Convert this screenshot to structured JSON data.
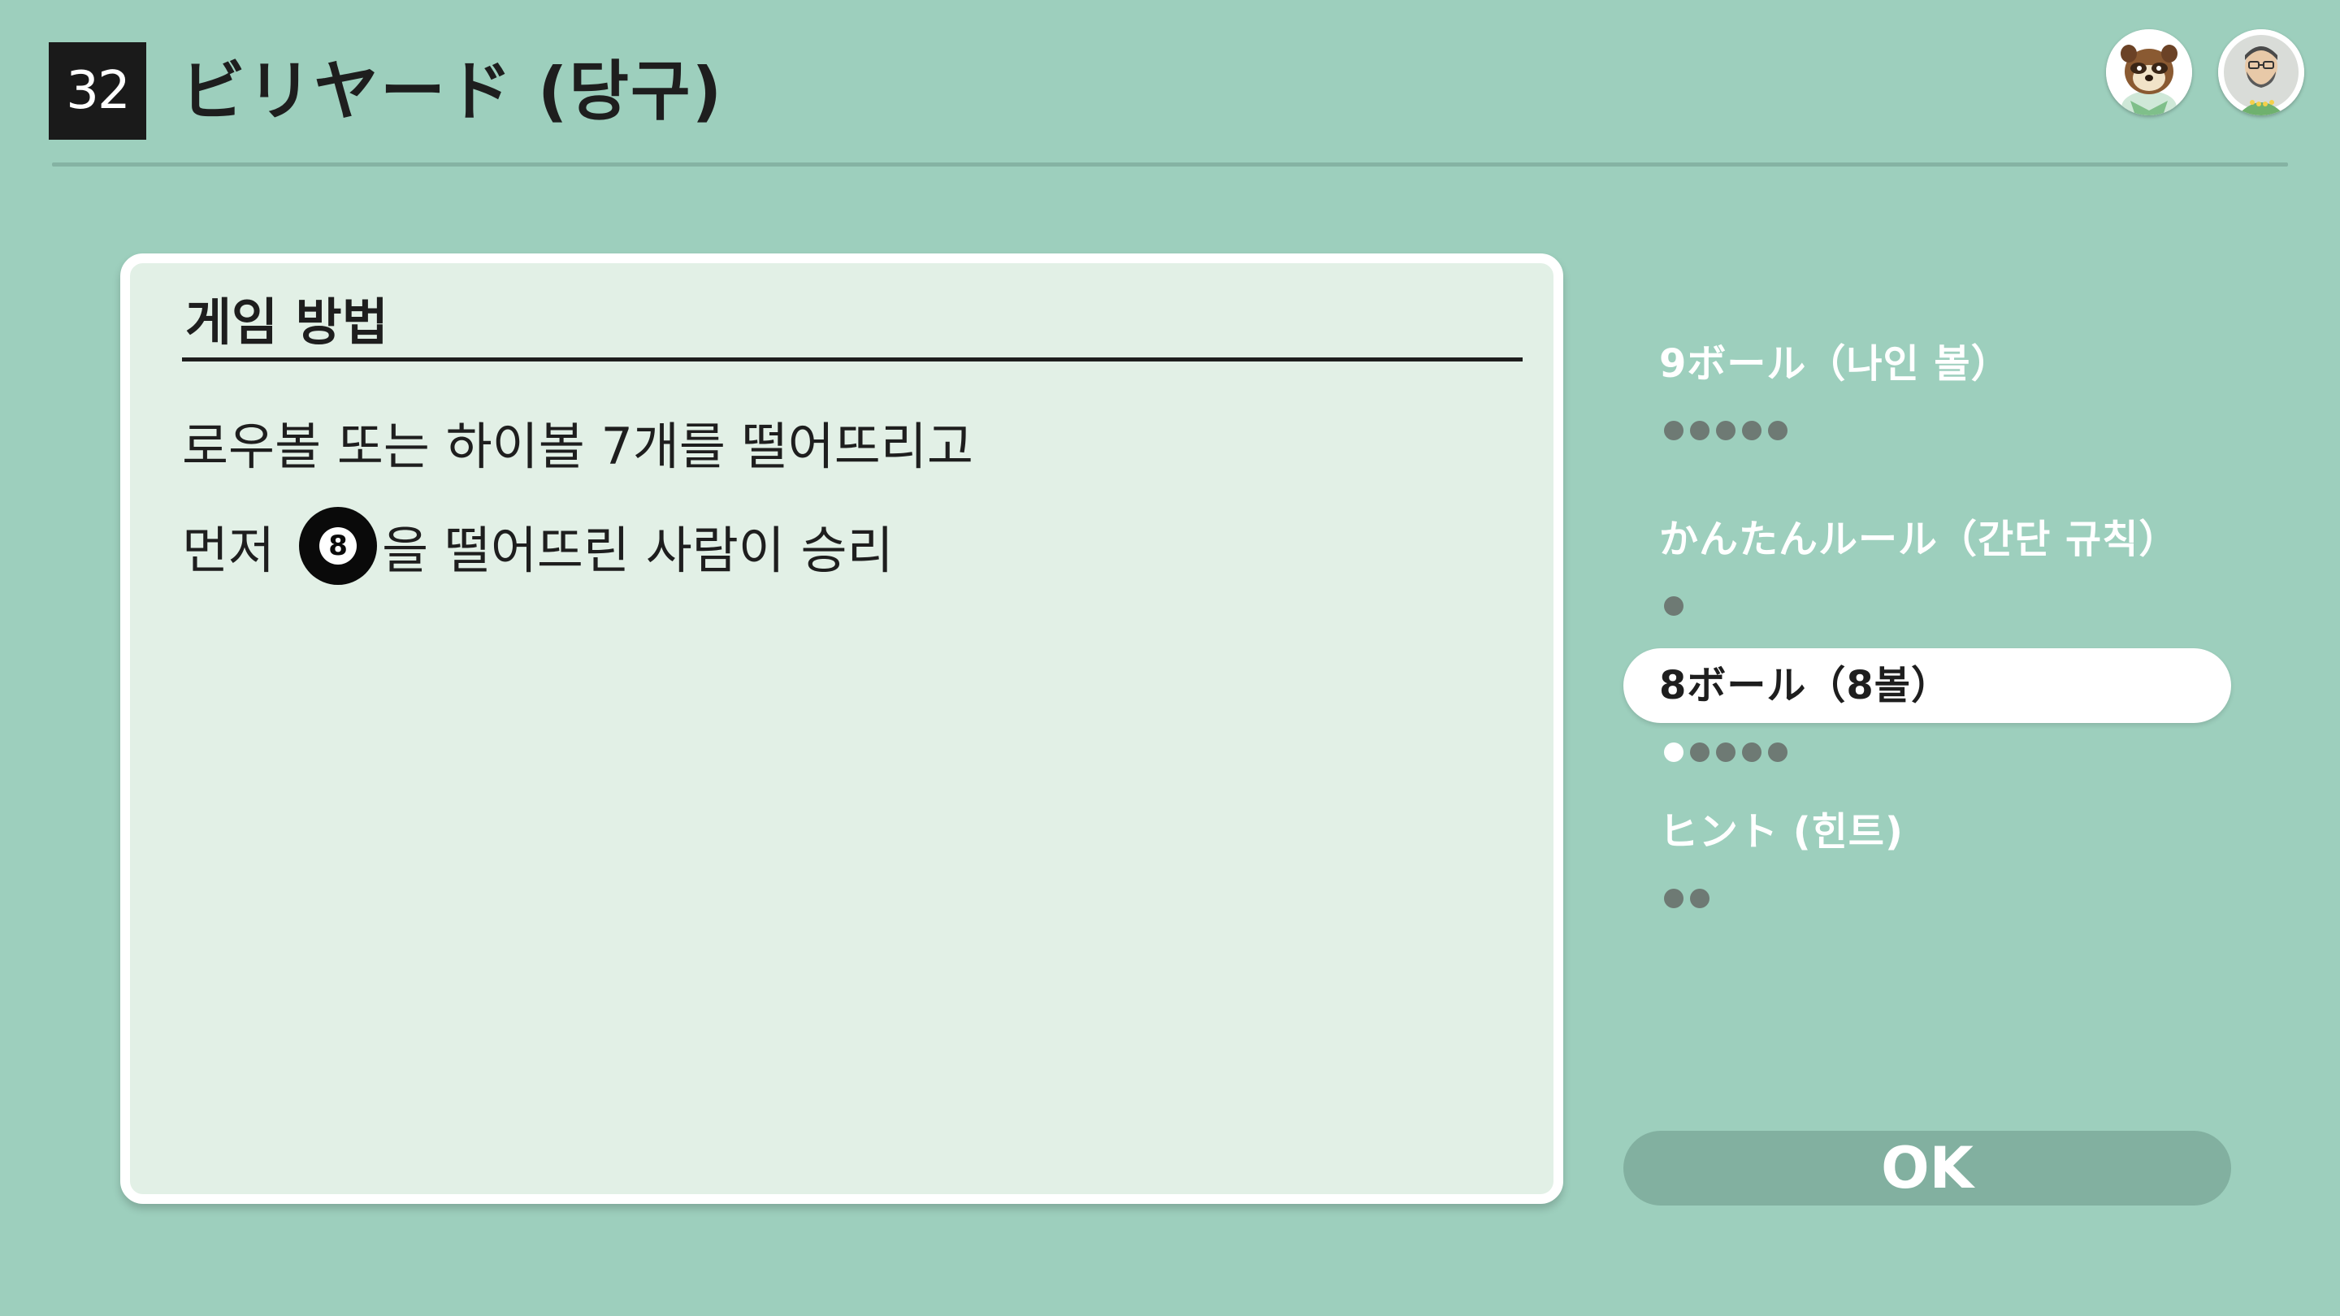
{
  "header": {
    "number": "32",
    "title": "ビリヤード (당구)"
  },
  "card": {
    "title": "게임 방법",
    "line1": "로우볼 또는 하이볼 7개를 떨어뜨리고",
    "line2_prefix": "먼저",
    "ball_number": "8",
    "line2_suffix": "을 떨어뜨린 사람이 승리"
  },
  "menu": {
    "items": [
      {
        "label": "9ボール（나인 볼）",
        "pages": 5,
        "current_page": null
      },
      {
        "label": "かんたんルール（간단 규칙）",
        "pages": 1,
        "current_page": null
      },
      {
        "label": "8ボール（8볼）",
        "pages": 5,
        "current_page": 1,
        "selected": true
      },
      {
        "label": "ヒント (힌트)",
        "pages": 2,
        "current_page": null
      }
    ]
  },
  "ok_button": {
    "label": "OK"
  },
  "colors": {
    "background": "#9dcfbd",
    "card": "#e2f0e6",
    "ok_button": "#82b0a0",
    "dot_inactive": "#6e7a74",
    "dot_active": "#ffffff"
  },
  "icons": {
    "avatar_1": "raccoon-character-avatar",
    "avatar_2": "bearded-man-avatar"
  }
}
